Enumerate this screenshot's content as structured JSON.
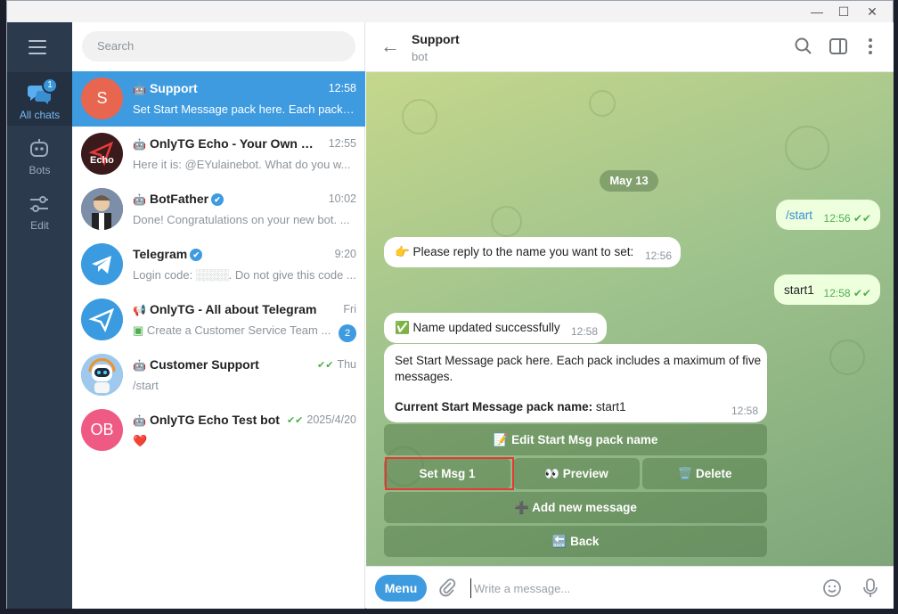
{
  "window_controls": {
    "minimize": "—",
    "maximize": "☐",
    "close": "✕"
  },
  "rail": {
    "items": [
      {
        "label": "All chats",
        "badge": "1"
      },
      {
        "label": "Bots"
      },
      {
        "label": "Edit"
      }
    ]
  },
  "search": {
    "placeholder": "Search"
  },
  "chats": [
    {
      "name": "Support",
      "time": "12:58",
      "preview": "Set Start Message pack here. Each pack i...",
      "avatar_text": "S",
      "avatar_color": "#e8664f"
    },
    {
      "name": "OnlyTG Echo - Your Own Busi...",
      "time": "12:55",
      "preview": "Here it is: @EYulainebot. What do you w...",
      "avatar_text": "Echo",
      "avatar_color": "#3a1a1a"
    },
    {
      "name": "BotFather",
      "time": "10:02",
      "preview": "Done! Congratulations on your new bot. ...",
      "avatar_color": "#6b7f9a"
    },
    {
      "name": "Telegram",
      "time": "9:20",
      "preview": "Login code: ░░░░. Do not give this code ...",
      "avatar_color": "#3a9be0"
    },
    {
      "name": "OnlyTG - All about Telegram",
      "time": "Fri",
      "preview": "Create a Customer Service Team ...",
      "unread": "2",
      "avatar_color": "#3a9be0"
    },
    {
      "name": "Customer Support",
      "time": "Thu",
      "preview": "/start",
      "avatar_color": "#8fc0e8"
    },
    {
      "name": "OnlyTG Echo Test bot",
      "time": "2025/4/20",
      "preview": "❤️",
      "avatar_text": "OB",
      "avatar_color": "#ef5a84"
    }
  ],
  "header": {
    "title": "Support",
    "subtitle": "bot"
  },
  "conversation": {
    "date": "May 13",
    "messages": [
      {
        "dir": "out",
        "text": "/start",
        "time": "12:56"
      },
      {
        "dir": "in",
        "text": "👉 Please reply to the name you want to set:",
        "time": "12:56"
      },
      {
        "dir": "out",
        "text": "start1",
        "time": "12:58"
      },
      {
        "dir": "in",
        "text": "✅ Name updated successfully",
        "time": "12:58"
      },
      {
        "dir": "in",
        "line1": "Set Start Message pack here. Each pack includes a maximum of five",
        "line2": "messages.",
        "bold": "Current Start Message pack name:",
        "value": "start1",
        "time": "12:58"
      }
    ],
    "keyboard": {
      "edit": "📝 Edit Start Msg pack name",
      "set_msg": "Set Msg 1",
      "preview": "👀 Preview",
      "delete": "🗑️ Delete",
      "add": "➕ Add new message",
      "back": "🔙 Back"
    }
  },
  "composer": {
    "menu": "Menu",
    "placeholder": "Write a message..."
  },
  "colors": {
    "accent": "#3e9be0",
    "rail": "#2b3a4d",
    "highlight": "#e53935"
  }
}
